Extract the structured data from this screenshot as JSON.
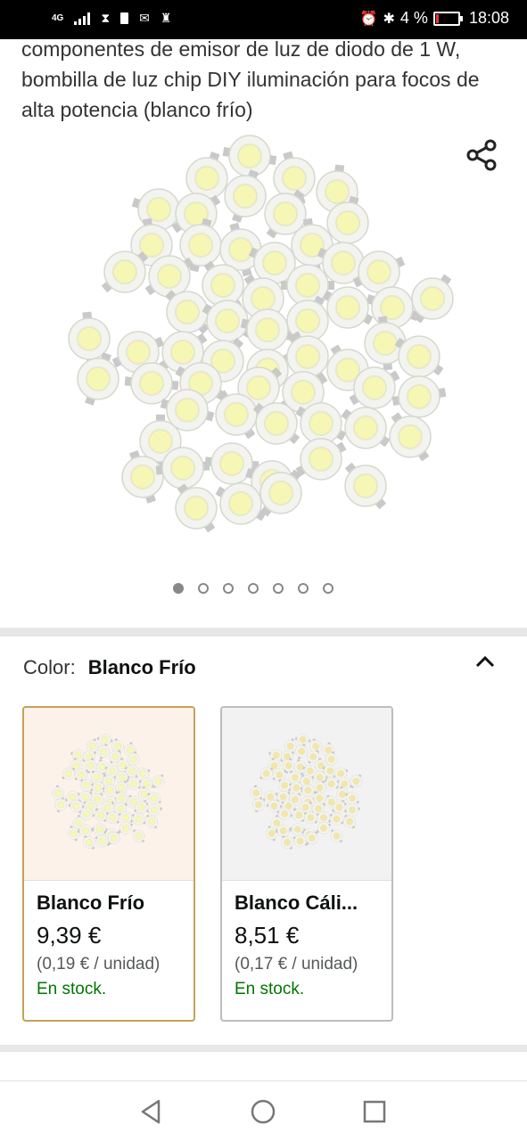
{
  "status_bar": {
    "network": "4G",
    "battery_percent": "4 %",
    "time": "18:08",
    "icons": [
      "signal-icon",
      "hourglass-icon",
      "sim-icon",
      "mail-icon",
      "chess-icon",
      "alarm-icon",
      "bluetooth-icon",
      "battery-icon"
    ]
  },
  "product": {
    "title": "componentes de emisor de luz de diodo de 1 W, bombilla de luz chip DIY iluminación para focos de alta potencia (blanco frío)",
    "image_count": 7,
    "active_image_index": 0
  },
  "color_selector": {
    "label": "Color:",
    "selected_value": "Blanco Frío",
    "options": [
      {
        "name": "Blanco Frío",
        "price": "9,39 €",
        "unit_price": "(0,19 € / unidad)",
        "stock": "En stock.",
        "selected": true
      },
      {
        "name": "Blanco Cáli...",
        "price": "8,51 €",
        "unit_price": "(0,17 € / unidad)",
        "stock": "En stock.",
        "selected": false
      }
    ]
  },
  "colors": {
    "stock_green": "#007600",
    "selected_border": "#c7a05a",
    "selected_bg": "#fdf2e9"
  },
  "nav": [
    "back-icon",
    "home-icon",
    "recents-icon"
  ]
}
